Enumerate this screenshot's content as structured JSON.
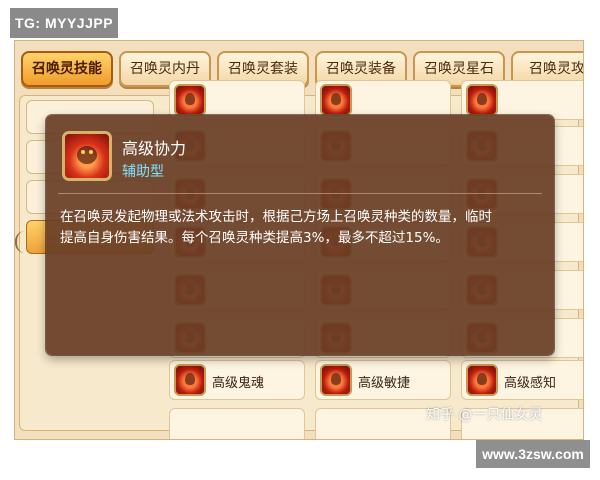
{
  "watermarks": {
    "top_left": "TG: MYYJJPP",
    "bottom_right": "www.3zsw.com",
    "zhihu": "知乎 @一只仙女灵"
  },
  "tabs": [
    {
      "label": "召唤灵技能",
      "active": true
    },
    {
      "label": "召唤灵内丹",
      "active": false
    },
    {
      "label": "召唤灵套装",
      "active": false
    },
    {
      "label": "召唤灵装备",
      "active": false
    },
    {
      "label": "召唤灵星石",
      "active": false
    },
    {
      "label": "召唤灵攻",
      "active": false
    }
  ],
  "skills_visible": [
    {
      "name": "高级鬼魂",
      "icon": "ghost-skill-icon"
    },
    {
      "name": "高级敏捷",
      "icon": "agility-skill-icon"
    },
    {
      "name": "高级感知",
      "icon": "perception-skill-icon"
    }
  ],
  "popup": {
    "title": "高级协力",
    "subtype": "辅助型",
    "description_lines": [
      "在召唤灵发起物理或法术攻击时，根据己方场上召唤灵种类的数量，临时",
      "提高自身伤害结果。每个召唤灵种类提高3%，最多不超过15%。"
    ],
    "icon": "cooperation-skill-icon"
  },
  "colors": {
    "background": "#f3dfbd",
    "popup": "#693e26",
    "subtype_text": "#7ee3ff",
    "active_tab": "#f09c2c"
  }
}
